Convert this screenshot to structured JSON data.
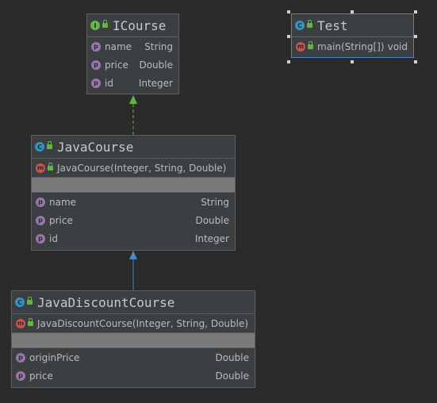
{
  "icourse": {
    "kind_icon": "I",
    "name": "ICourse",
    "fields": [
      {
        "icon": "p",
        "name": "name",
        "type": "String"
      },
      {
        "icon": "p",
        "name": "price",
        "type": "Double"
      },
      {
        "icon": "p",
        "name": "id",
        "type": "Integer"
      }
    ]
  },
  "test": {
    "kind_icon": "C",
    "name": "Test",
    "methods": [
      {
        "icon": "m",
        "name": "main(String[])",
        "type": "void"
      }
    ]
  },
  "javacourse": {
    "kind_icon": "C",
    "name": "JavaCourse",
    "methods": [
      {
        "icon": "m",
        "name": "JavaCourse(Integer, String, Double)",
        "type": ""
      }
    ],
    "fields": [
      {
        "icon": "p",
        "name": "name",
        "type": "String"
      },
      {
        "icon": "p",
        "name": "price",
        "type": "Double"
      },
      {
        "icon": "p",
        "name": "id",
        "type": "Integer"
      }
    ]
  },
  "javadiscountcourse": {
    "kind_icon": "C",
    "name": "JavaDiscountCourse",
    "methods": [
      {
        "icon": "m",
        "name": "JavaDiscountCourse(Integer, String, Double)",
        "type": ""
      }
    ],
    "fields": [
      {
        "icon": "p",
        "name": "originPrice",
        "type": "Double"
      },
      {
        "icon": "p",
        "name": "price",
        "type": "Double"
      }
    ]
  },
  "colors": {
    "background": "#2b2b2b",
    "node": "#3c3f41",
    "selection": "#4a88c7",
    "realization_arrow": "#62b543",
    "inheritance_arrow": "#4a88c7"
  }
}
